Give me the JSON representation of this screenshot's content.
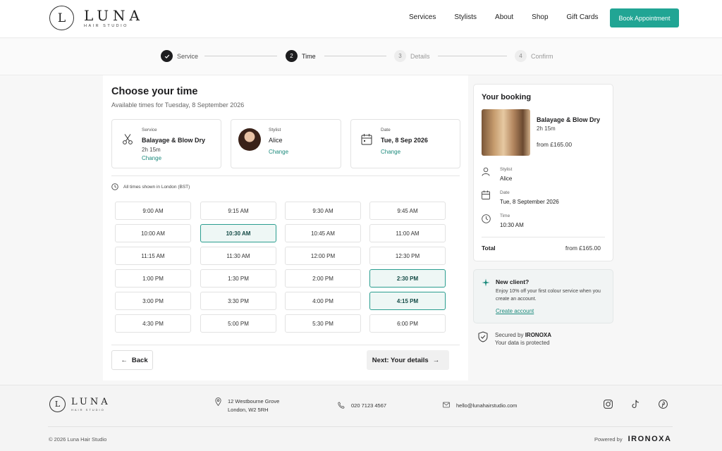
{
  "brand": {
    "initial": "L",
    "name": "LUNA",
    "tagline": "HAIR STUDIO"
  },
  "nav": {
    "items": [
      "Services",
      "Stylists",
      "About",
      "Shop",
      "Gift Cards"
    ],
    "book_label": "Book Appointment"
  },
  "stepper": {
    "steps": [
      {
        "num": "",
        "label": "Service",
        "state": "done"
      },
      {
        "num": "2",
        "label": "Time",
        "state": "active"
      },
      {
        "num": "3",
        "label": "Details",
        "state": "todo"
      },
      {
        "num": "4",
        "label": "Confirm",
        "state": "todo"
      }
    ]
  },
  "main": {
    "title": "Choose your time",
    "subtitle": "Available times for Tuesday, 8 September 2026",
    "service": {
      "label": "Service",
      "value": "Balayage & Blow Dry",
      "duration": "2h 15m",
      "change": "Change"
    },
    "stylist": {
      "label": "Stylist",
      "value": "Alice",
      "change": "Change"
    },
    "date": {
      "label": "Date",
      "value": "Tue, 8 Sep 2026",
      "change": "Change"
    },
    "timezone_note": "All times shown in London (BST)",
    "slots": [
      [
        "9:00 AM",
        "9:15 AM",
        "9:30 AM",
        "9:45 AM"
      ],
      [
        "10:00 AM",
        "10:30 AM",
        "10:45 AM",
        "11:00 AM"
      ],
      [
        "11:15 AM",
        "11:30 AM",
        "12:00 PM",
        "12:30 PM"
      ],
      [
        "1:00 PM",
        "1:30 PM",
        "2:00 PM",
        "2:30 PM"
      ],
      [
        "3:00 PM",
        "3:30 PM",
        "4:00 PM",
        "4:15 PM"
      ],
      [
        "4:30 PM",
        "5:00 PM",
        "5:30 PM",
        "6:00 PM"
      ]
    ],
    "highlighted_slots": [
      "10:30 AM",
      "2:30 PM",
      "4:15 PM"
    ],
    "back_label": "Back",
    "next_label": "Next: Your details"
  },
  "summary": {
    "title": "Your booking",
    "service": "Balayage & Blow Dry",
    "duration": "2h 15m",
    "price": "from £165.00",
    "stylist_label": "Stylist",
    "stylist": "Alice",
    "date_label": "Date",
    "date": "Tue, 8 September 2026",
    "time_label": "Time",
    "time": "10:30 AM",
    "total_label": "Total",
    "total": "from £165.00"
  },
  "promo": {
    "title": "New client?",
    "text": "Enjoy 10% off your first colour service when you create an account.",
    "link": "Create account"
  },
  "secure": {
    "prefix": "Secured by",
    "brand": "IRONOXA",
    "note": "Your data is protected"
  },
  "footer": {
    "address_line1": "12 Westbourne Grove",
    "address_line2": "London, W2 5RH",
    "phone": "020 7123 4567",
    "email": "hello@lunahairstudio.com",
    "copyright": "© 2026 Luna Hair Studio",
    "powered_label": "Powered by",
    "powered_brand": "IRONOXA"
  },
  "colors": {
    "accent": "#21a594",
    "link": "#1b8a7c",
    "dark": "#1d1d1f"
  },
  "icons": [
    "scissors-icon",
    "calendar-icon",
    "clock-icon",
    "user-icon",
    "sparkle-icon",
    "shield-icon",
    "map-pin-icon",
    "phone-icon",
    "mail-icon",
    "instagram-icon",
    "tiktok-icon",
    "pinterest-icon"
  ]
}
